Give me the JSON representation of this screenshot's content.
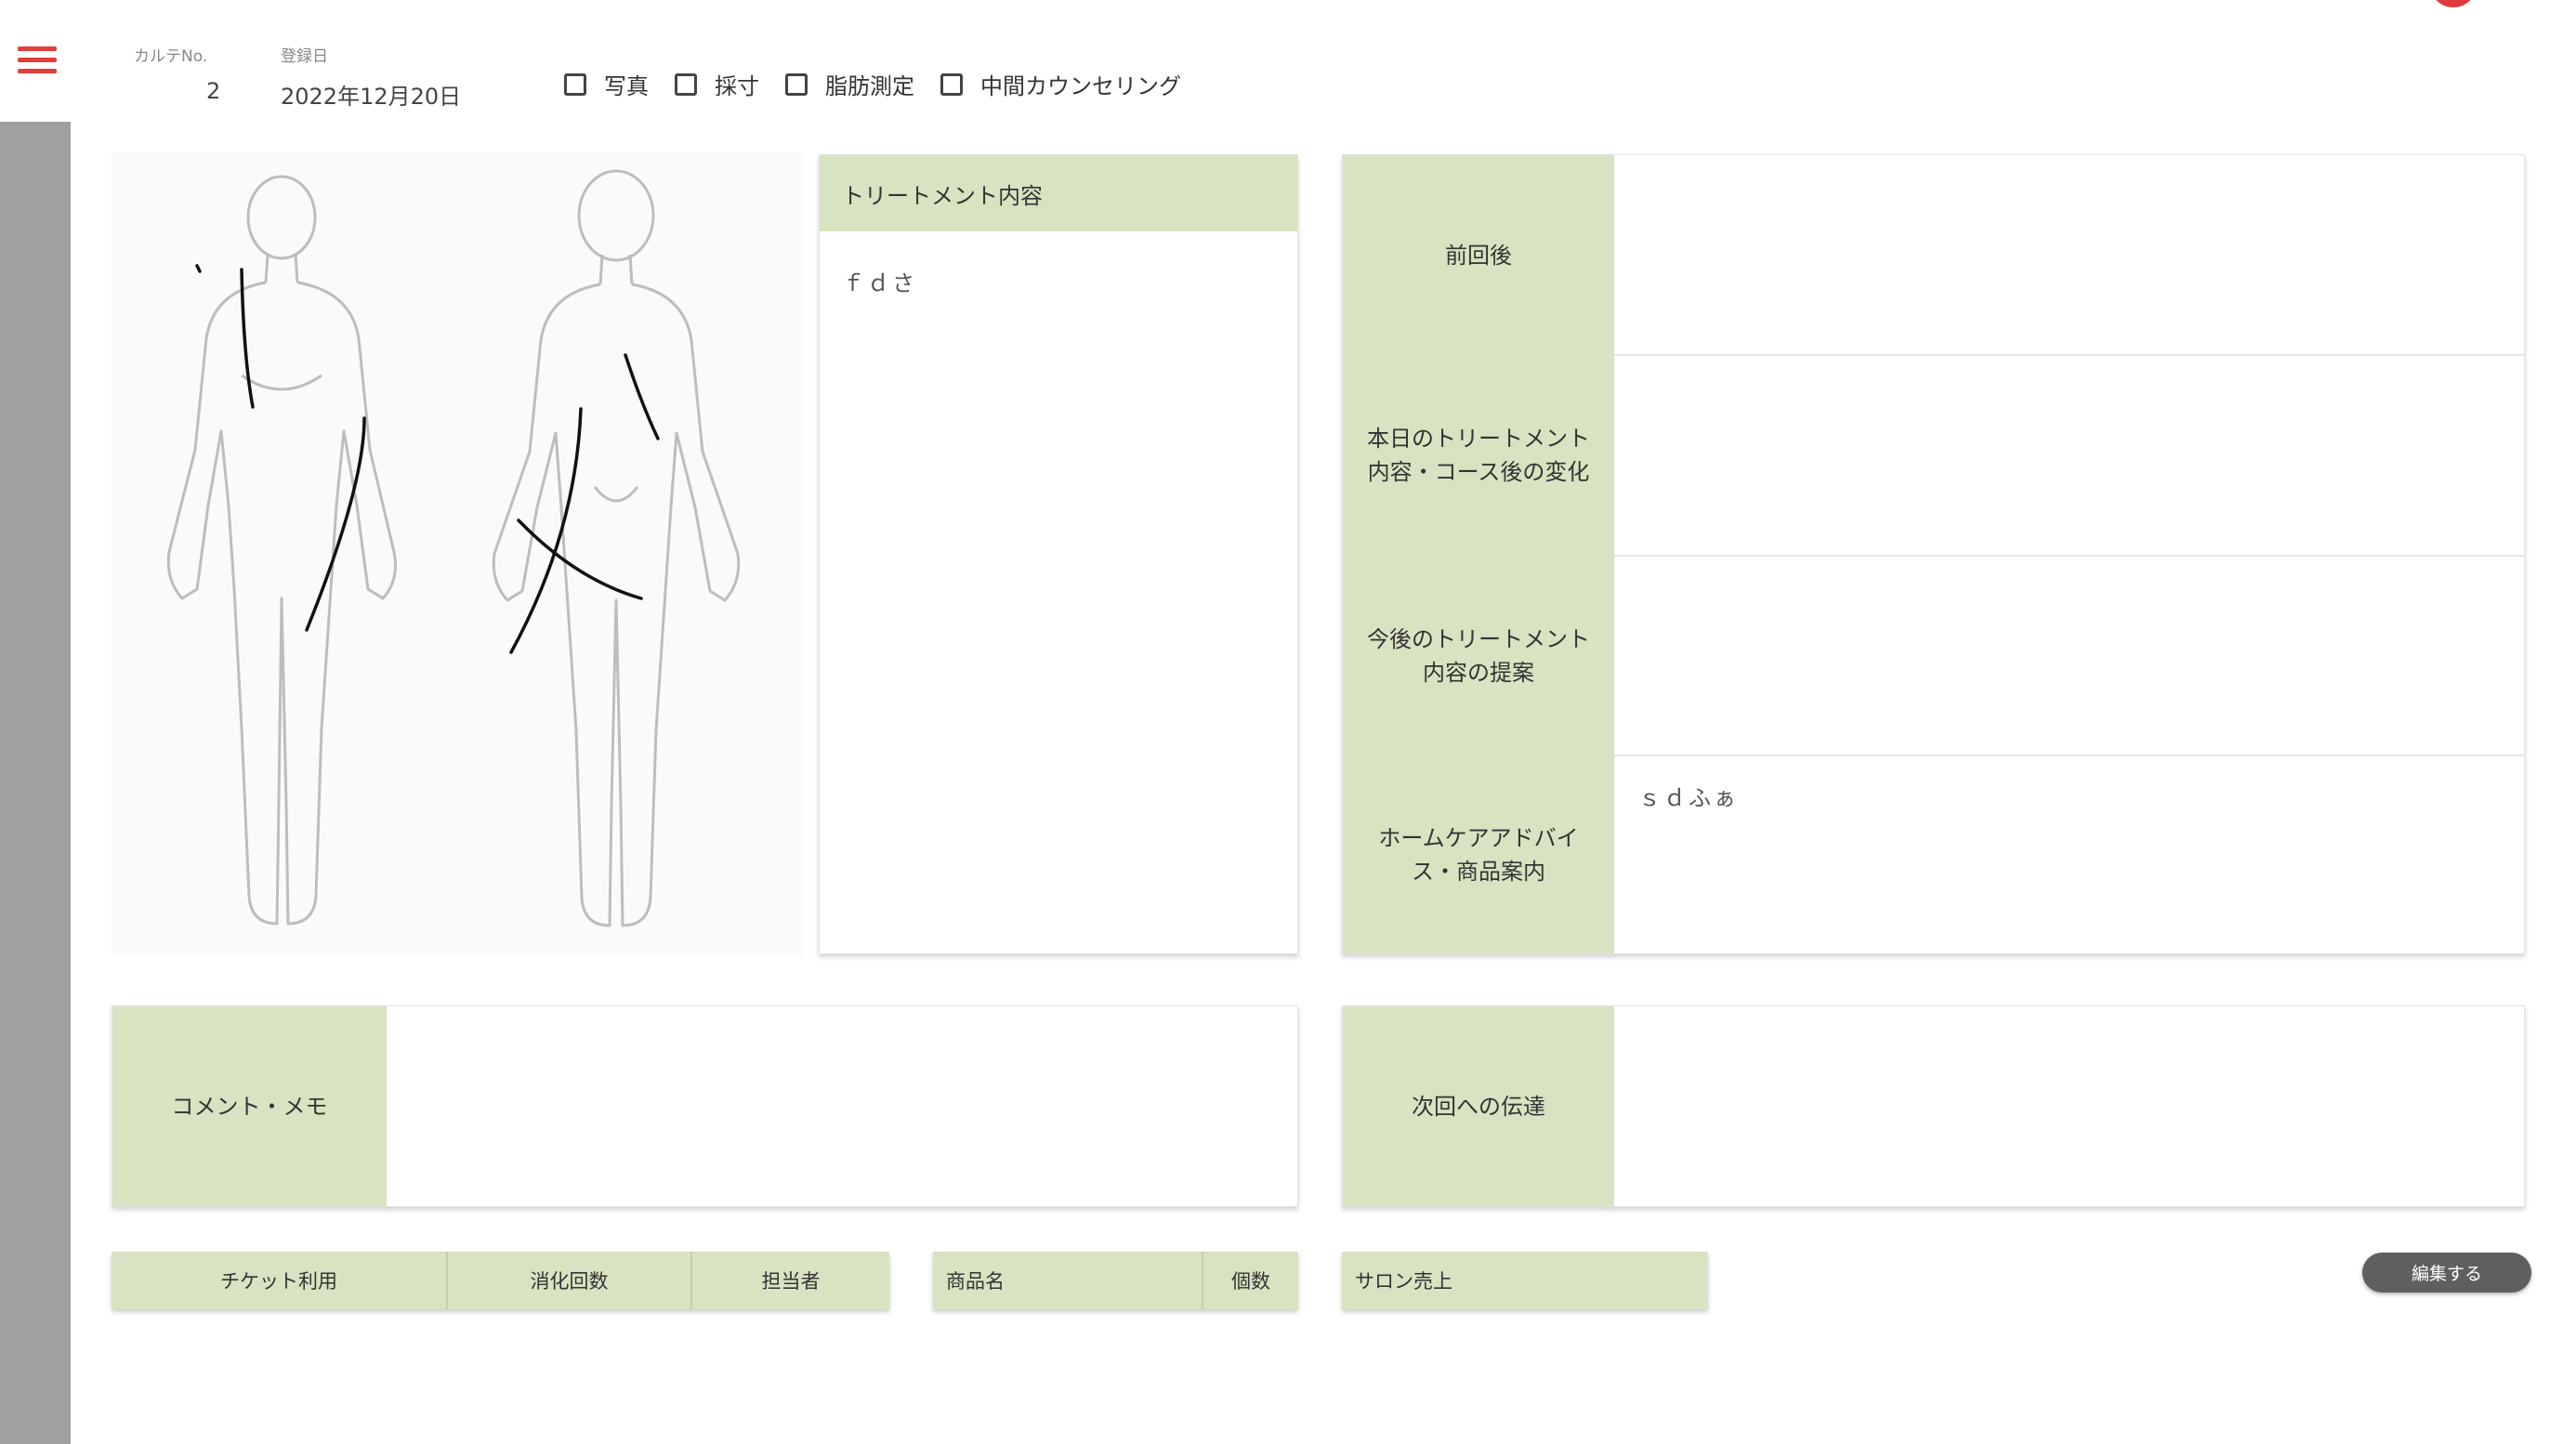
{
  "header": {
    "karte_no_label": "カルテNo.",
    "karte_no_value": "2",
    "registered_label": "登録日",
    "registered_value": "2022年12月20日",
    "checkboxes": [
      {
        "label": "写真",
        "checked": false
      },
      {
        "label": "採寸",
        "checked": false
      },
      {
        "label": "脂肪測定",
        "checked": false
      },
      {
        "label": "中間カウンセリング",
        "checked": false
      }
    ]
  },
  "treatment": {
    "title": "トリートメント内容",
    "content": "ｆｄさ"
  },
  "right_panel": {
    "rows": [
      {
        "label": "前回後",
        "content": ""
      },
      {
        "label": "本日のトリートメント\n内容・コース後の変化",
        "content": ""
      },
      {
        "label": "今後のトリートメント\n内容の提案",
        "content": ""
      },
      {
        "label": "ホームケアアドバイ\nス・商品案内",
        "content": "ｓｄふぁ"
      }
    ]
  },
  "comment": {
    "label": "コメント・メモ",
    "content": ""
  },
  "next_notice": {
    "label": "次回への伝達",
    "content": ""
  },
  "ticket_table": {
    "headers": [
      "チケット利用",
      "消化回数",
      "担当者"
    ]
  },
  "product_table": {
    "headers": [
      "商品名",
      "個数"
    ]
  },
  "salon_table": {
    "headers": [
      "サロン売上"
    ]
  },
  "edit_button": {
    "label": "編集する"
  },
  "colors": {
    "accent_green": "#d7e3c1",
    "menu_red": "#e0403a",
    "rail_gray": "#a0a0a0",
    "button_gray": "#5f5f5f"
  }
}
